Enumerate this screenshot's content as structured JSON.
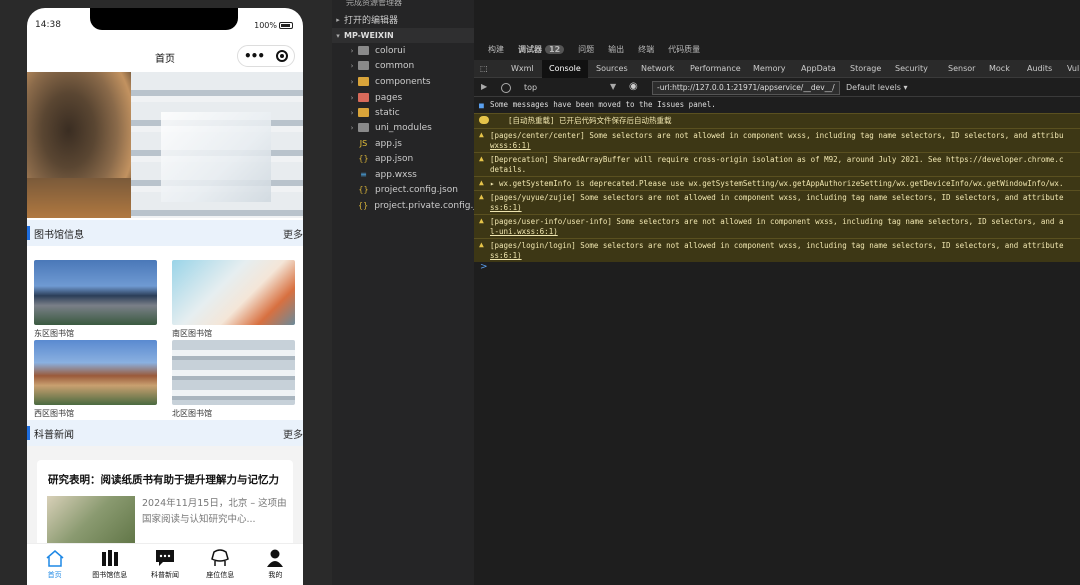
{
  "phone": {
    "time": "14:38",
    "battery": "100%",
    "nav_title": "首页",
    "sections": {
      "library": {
        "title": "图书馆信息",
        "more": "更多"
      },
      "news": {
        "title": "科普新闻",
        "more": "更多"
      }
    },
    "libraries": [
      {
        "name": "东区图书馆"
      },
      {
        "name": "南区图书馆"
      },
      {
        "name": "西区图书馆"
      },
      {
        "name": "北区图书馆"
      }
    ],
    "news_item": {
      "title": "研究表明：阅读纸质书有助于提升理解力与记忆力",
      "summary": "2024年11月15日，北京 – 这项由国家阅读与认知研究中心..."
    },
    "tabs": [
      {
        "label": "首页",
        "icon": "home-icon"
      },
      {
        "label": "图书馆信息",
        "icon": "library-icon"
      },
      {
        "label": "科普新闻",
        "icon": "news-icon"
      },
      {
        "label": "座位信息",
        "icon": "seat-icon"
      },
      {
        "label": "我的",
        "icon": "user-icon"
      }
    ]
  },
  "explorer": {
    "top_label": "完成资源管理器",
    "open_editors": "打开的编辑器",
    "project": "MP-WEIXIN",
    "items": [
      {
        "name": "colorui",
        "type": "folder"
      },
      {
        "name": "common",
        "type": "folder"
      },
      {
        "name": "components",
        "type": "folder-y"
      },
      {
        "name": "pages",
        "type": "folder-r"
      },
      {
        "name": "static",
        "type": "folder-y"
      },
      {
        "name": "uni_modules",
        "type": "folder"
      },
      {
        "name": "app.js",
        "type": "js"
      },
      {
        "name": "app.json",
        "type": "json"
      },
      {
        "name": "app.wxss",
        "type": "wxss"
      },
      {
        "name": "project.config.json",
        "type": "json"
      },
      {
        "name": "project.private.config.js...",
        "type": "json"
      }
    ]
  },
  "devtools": {
    "top_tabs": [
      "构建",
      "调试器",
      "问题",
      "输出",
      "终端",
      "代码质量"
    ],
    "debugger_badge": "12",
    "panel_tabs": [
      "Wxml",
      "Console",
      "Sources",
      "Network",
      "Performance",
      "Memory",
      "AppData",
      "Storage",
      "Security",
      "Sensor",
      "Mock",
      "Audits",
      "Vul"
    ],
    "context": "top",
    "filter_value": "-url:http://127.0.0.1:21971/appservice/__dev__/",
    "levels": "Default levels",
    "logs": [
      {
        "kind": "info",
        "line1": "Some messages have been moved to the Issues panel."
      },
      {
        "kind": "hot",
        "line1": "[自动热重载] 已开启代码文件保存后自动热重载"
      },
      {
        "kind": "warn",
        "line1": "[pages/center/center] Some selectors are not allowed in component wxss, including tag name selectors, ID selectors, and attribu",
        "line2": "wxss:6:1)"
      },
      {
        "kind": "warn",
        "line1": "[Deprecation] SharedArrayBuffer will require cross-origin isolation as of M92, around July 2021. See https://developer.chrome.c",
        "line2": "details."
      },
      {
        "kind": "warn",
        "line1": "▸ wx.getSystemInfo is deprecated.Please use wx.getSystemSetting/wx.getAppAuthorizeSetting/wx.getDeviceInfo/wx.getWindowInfo/wx."
      },
      {
        "kind": "warn",
        "line1": "[pages/yuyue/zujie] Some selectors are not allowed in component wxss, including tag name selectors, ID selectors, and attribute",
        "line2": "ss:6:1)"
      },
      {
        "kind": "warn",
        "line1": "[pages/user-info/user-info] Some selectors are not allowed in component wxss, including tag name selectors, ID selectors, and a",
        "line2": "l-uni.wxss:6:1)"
      },
      {
        "kind": "warn",
        "line1": "[pages/login/login] Some selectors are not allowed in component wxss, including tag name selectors, ID selectors, and attribute",
        "line2": "ss:6:1)"
      }
    ],
    "prompt": ">"
  },
  "colors": {
    "accent": "#1e6ee0",
    "tab_active": "#1e88e5",
    "warn_bg": "#3d3715",
    "warn_icon": "#e6c44a",
    "info_icon": "#5aa0f0"
  }
}
